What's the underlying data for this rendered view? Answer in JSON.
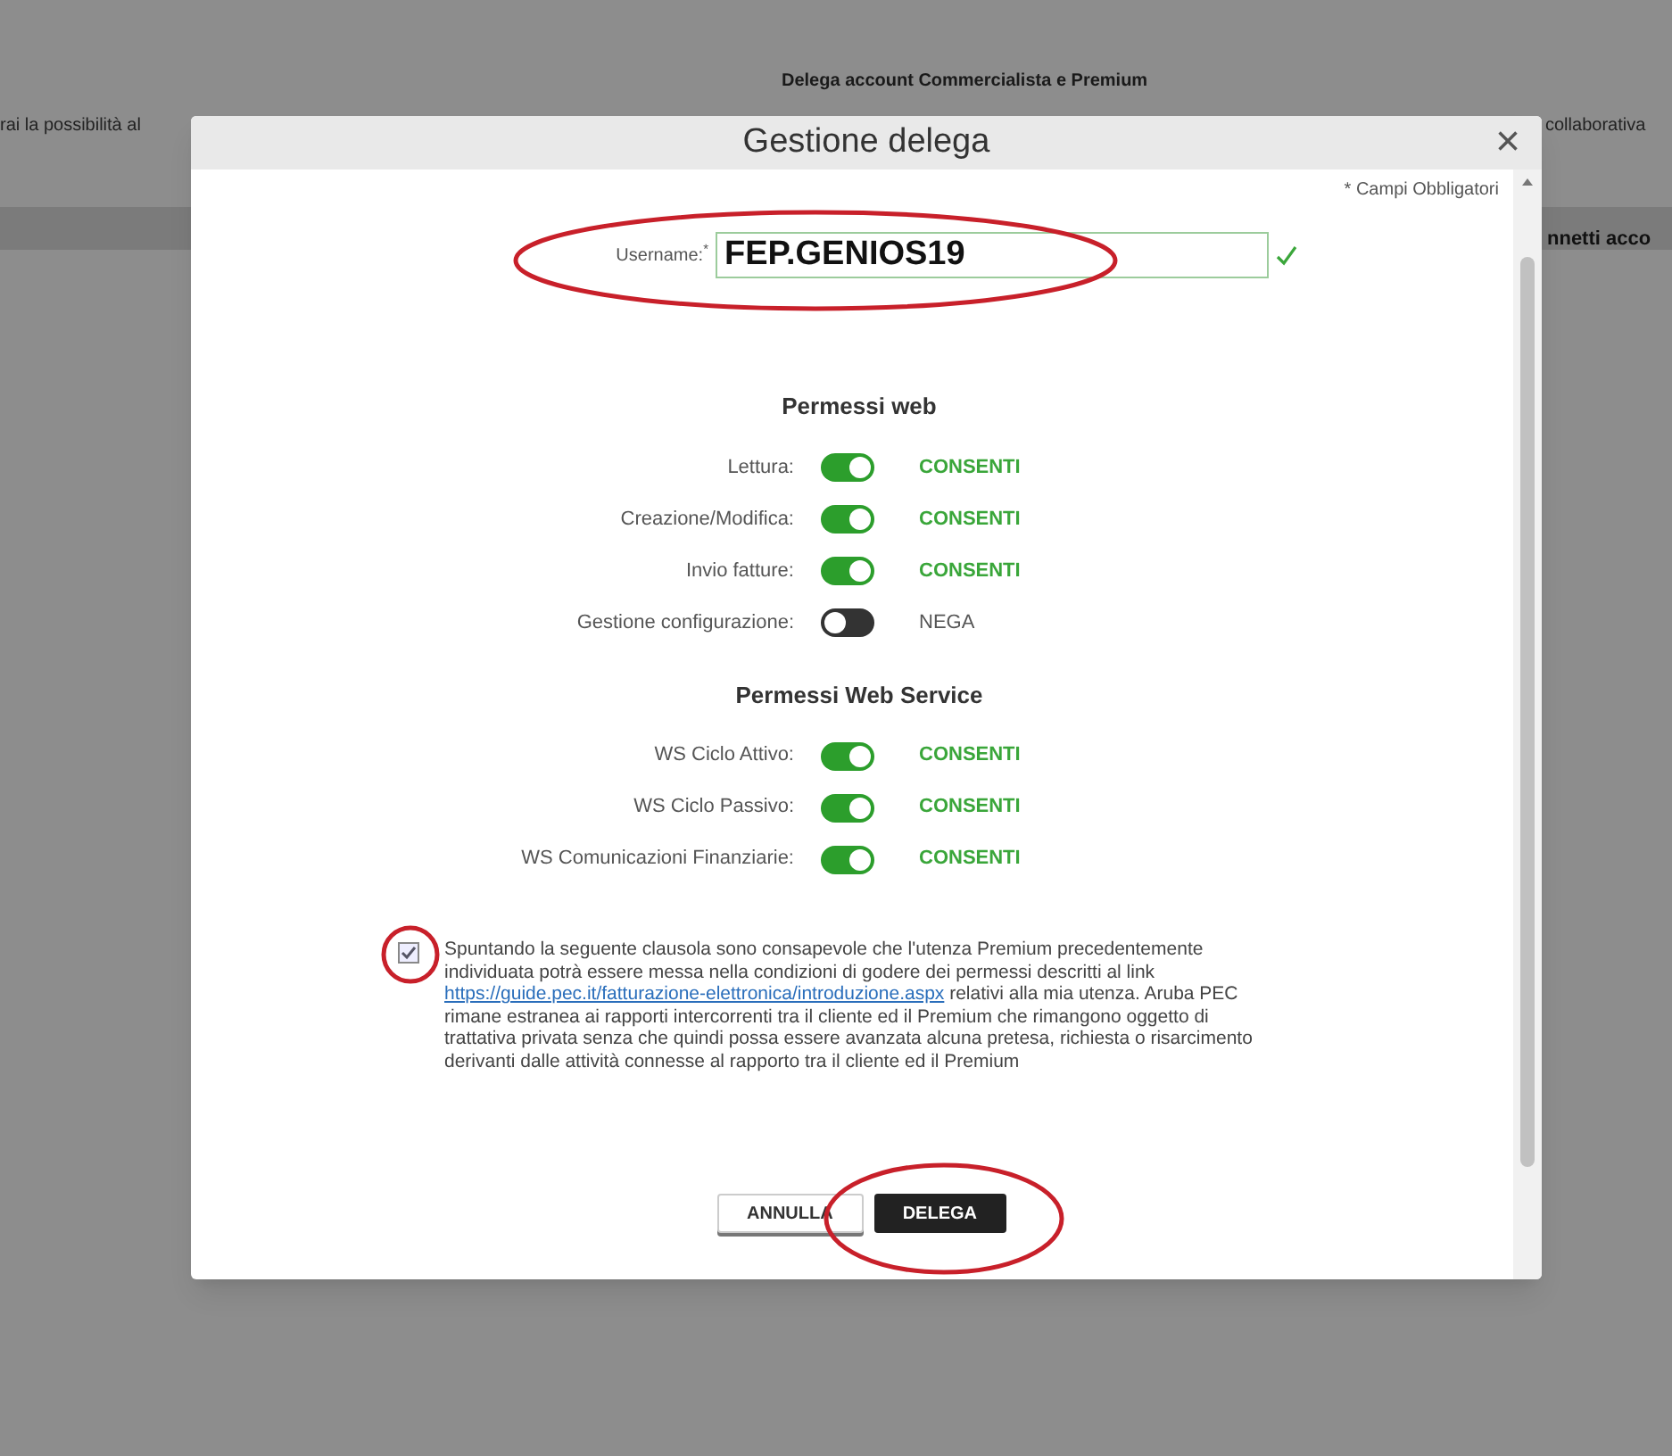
{
  "background": {
    "heading": "Delega account Commercialista e Premium",
    "text_left": "rai la possibilità al",
    "text_right": "collaborativa",
    "text_right_bold": "nnetti acco"
  },
  "dialog": {
    "title": "Gestione delega",
    "close": "×",
    "required_note": "* Campi Obbligatori",
    "username": {
      "label": "Username:",
      "required_mark": "*",
      "value": "FEP.GENIOS19",
      "valid": true
    },
    "sections": [
      {
        "title": "Permessi web",
        "permissions": [
          {
            "label": "Lettura:",
            "on": true,
            "status": "CONSENTI"
          },
          {
            "label": "Creazione/Modifica:",
            "on": true,
            "status": "CONSENTI"
          },
          {
            "label": "Invio fatture:",
            "on": true,
            "status": "CONSENTI"
          },
          {
            "label": "Gestione configurazione:",
            "on": false,
            "status": "NEGA"
          }
        ]
      },
      {
        "title": "Permessi Web Service",
        "permissions": [
          {
            "label": "WS Ciclo Attivo:",
            "on": true,
            "status": "CONSENTI"
          },
          {
            "label": "WS Ciclo Passivo:",
            "on": true,
            "status": "CONSENTI"
          },
          {
            "label": "WS Comunicazioni Finanziarie:",
            "on": true,
            "status": "CONSENTI"
          }
        ]
      }
    ],
    "consent": {
      "checked": true,
      "text_before": "Spuntando la seguente clausola sono consapevole che l'utenza Premium precedentemente individuata potrà essere messa nella condizioni di godere dei permessi descritti al link",
      "link": "https://guide.pec.it/fatturazione-elettronica/introduzione.aspx",
      "text_after": "relativi alla mia utenza. Aruba PEC rimane estranea ai rapporti intercorrenti tra il cliente ed il Premium che rimangono oggetto di trattativa privata senza che quindi possa essere avanzata alcuna pretesa, richiesta o risarcimento derivanti dalle attività connesse al rapporto tra il cliente ed il Premium"
    },
    "buttons": [
      {
        "label": "ANNULLA",
        "kind": "secondary"
      },
      {
        "label": "DELEGA",
        "kind": "primary"
      }
    ]
  }
}
